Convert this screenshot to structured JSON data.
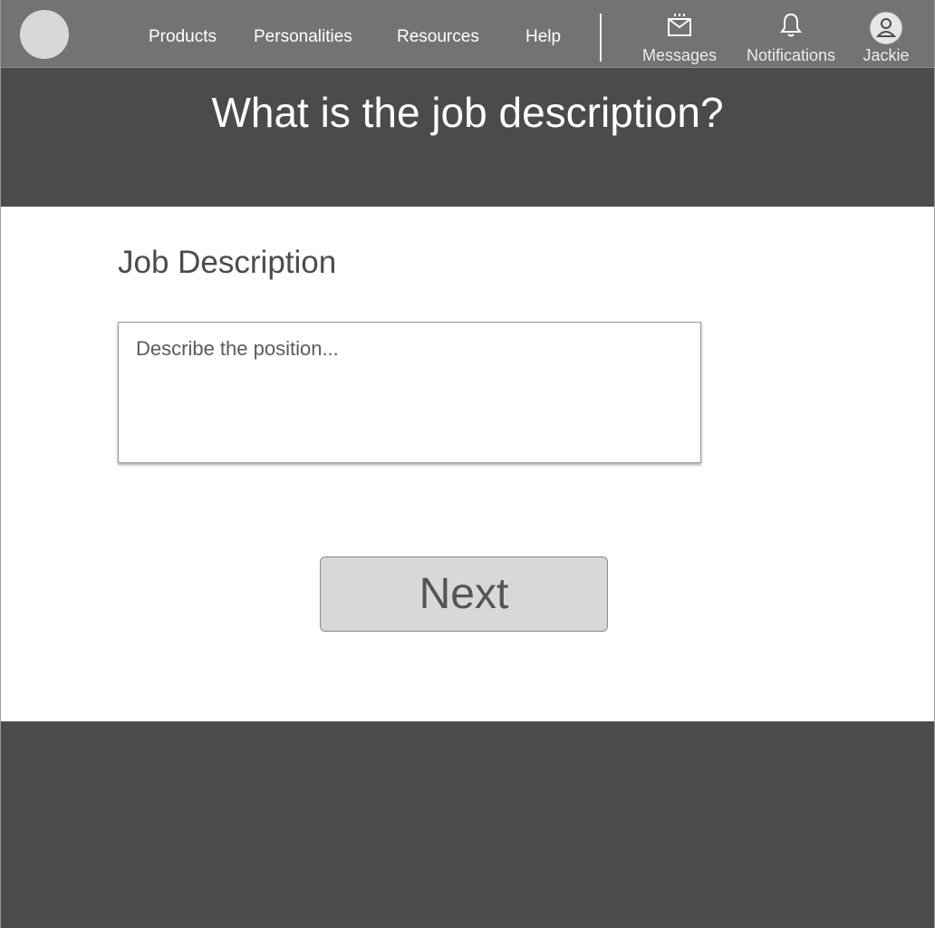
{
  "header": {
    "logo": "logo-placeholder",
    "nav": [
      {
        "label": "Products"
      },
      {
        "label": "Personalities"
      },
      {
        "label": "Resources"
      },
      {
        "label": "Help"
      }
    ],
    "actions": [
      {
        "label": "Messages",
        "icon": "mail-icon"
      },
      {
        "label": "Notifications",
        "icon": "bell-icon"
      },
      {
        "label": "Jackie",
        "icon": "user-avatar-icon"
      }
    ]
  },
  "hero": {
    "title": "What is the job description?"
  },
  "form": {
    "section_label": "Job Description",
    "description_field": {
      "value": "",
      "placeholder": "Describe the position..."
    },
    "next_label": "Next"
  },
  "colors": {
    "topbar": "#737373",
    "dark_band": "#4b4b4b",
    "content_bg": "#ffffff",
    "button_bg": "#d8d8d8"
  }
}
